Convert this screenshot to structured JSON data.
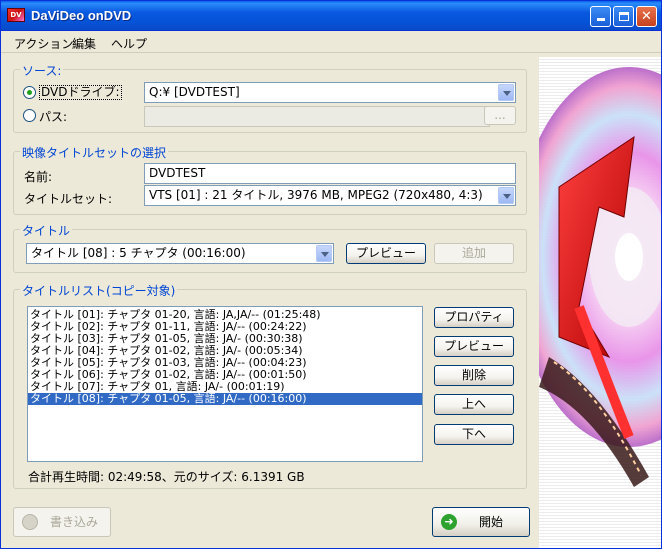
{
  "window": {
    "title": "DaViDeo onDVD",
    "icon_text": "DV",
    "minimize_icon": "minimize-icon",
    "maximize_icon": "maximize-icon",
    "close_icon": "close-icon"
  },
  "menu": [
    "アクション",
    "編集",
    "ヘルプ"
  ],
  "source": {
    "group_label": "ソース:",
    "dvd_drive_label": "DVDドライブ:",
    "dvd_drive_value": "Q:¥ [DVDTEST]",
    "dvd_drive_selected": true,
    "path_label": "パス:",
    "path_value": "",
    "browse_label": "..."
  },
  "titleset": {
    "group_label": "映像タイトルセットの選択",
    "name_label": "名前:",
    "name_value": "DVDTEST",
    "set_label": "タイトルセット:",
    "set_value": "VTS [01] :  21 タイトル, 3976 MB, MPEG2 (720x480, 4:3)"
  },
  "title": {
    "group_label": "タイトル",
    "selected_value": "タイトル [08] : 5 チャプタ (00:16:00)",
    "preview_label": "プレビュー",
    "add_label": "追加"
  },
  "title_list": {
    "group_label": "タイトルリスト(コピー対象)",
    "items": [
      "タイトル [01]: チャプタ 01-20, 言語: JA,JA/-- (01:25:48)",
      "タイトル [02]: チャプタ 01-11, 言語: JA/-- (00:24:22)",
      "タイトル [03]: チャプタ 01-05, 言語: JA/- (00:30:38)",
      "タイトル [04]: チャプタ 01-02, 言語: JA/- (00:05:34)",
      "タイトル [05]: チャプタ 01-03, 言語: JA/-- (00:04:23)",
      "タイトル [06]: チャプタ 01-02, 言語: JA/-- (00:01:50)",
      "タイトル [07]: チャプタ 01, 言語: JA/- (00:01:19)",
      "タイトル [08]: チャプタ 01-05, 言語: JA/-- (00:16:00)"
    ],
    "selected_index": 7,
    "buttons": {
      "properties": "プロパティ",
      "preview": "プレビュー",
      "delete": "削除",
      "up": "上へ",
      "down": "下へ"
    },
    "summary": "合計再生時間: 02:49:58、元のサイズ: 6.1391 GB"
  },
  "bottom": {
    "burn_label": "書き込み",
    "burn_icon": "disc-burn-icon",
    "start_label": "開始",
    "start_icon": "arrow-right-circle-icon"
  }
}
